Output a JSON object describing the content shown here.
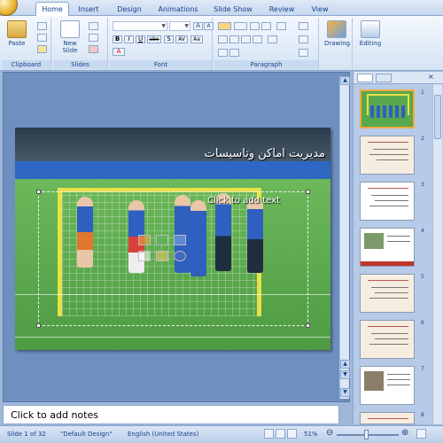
{
  "tabs": [
    "Home",
    "Insert",
    "Design",
    "Animations",
    "Slide Show",
    "Review",
    "View"
  ],
  "active_tab": "Home",
  "ribbon": {
    "groups": {
      "clipboard": "Clipboard",
      "slides": "Slides",
      "font": "Font",
      "paragraph": "Paragraph"
    },
    "paste": "Paste",
    "new_slide": "New Slide",
    "drawing": "Drawing",
    "editing": "Editing",
    "font_buttons": [
      "B",
      "I",
      "U",
      "abe",
      "S",
      "AV",
      "Aa",
      "A"
    ],
    "grow_shrink": [
      "A",
      "A"
    ]
  },
  "slide": {
    "title": "مديريت اماكن وتاسيسات",
    "placeholder": "Click to add text"
  },
  "thumbnails": [
    {
      "num": "1",
      "type": "photo",
      "selected": true
    },
    {
      "num": "2",
      "type": "text",
      "selected": false
    },
    {
      "num": "3",
      "type": "text",
      "selected": false
    },
    {
      "num": "4",
      "type": "photo-text",
      "selected": false
    },
    {
      "num": "5",
      "type": "text",
      "selected": false
    },
    {
      "num": "6",
      "type": "text",
      "selected": false
    },
    {
      "num": "7",
      "type": "photo-text",
      "selected": false
    },
    {
      "num": "8",
      "type": "text",
      "selected": false
    }
  ],
  "notes_placeholder": "Click to add notes",
  "status": {
    "slide": "Slide 1 of 32",
    "theme": "\"Default Design\"",
    "language": "English (United States)",
    "zoom": "51%"
  },
  "colors": {
    "ribbon_text": "#15428b",
    "selection": "#f2a93b"
  }
}
